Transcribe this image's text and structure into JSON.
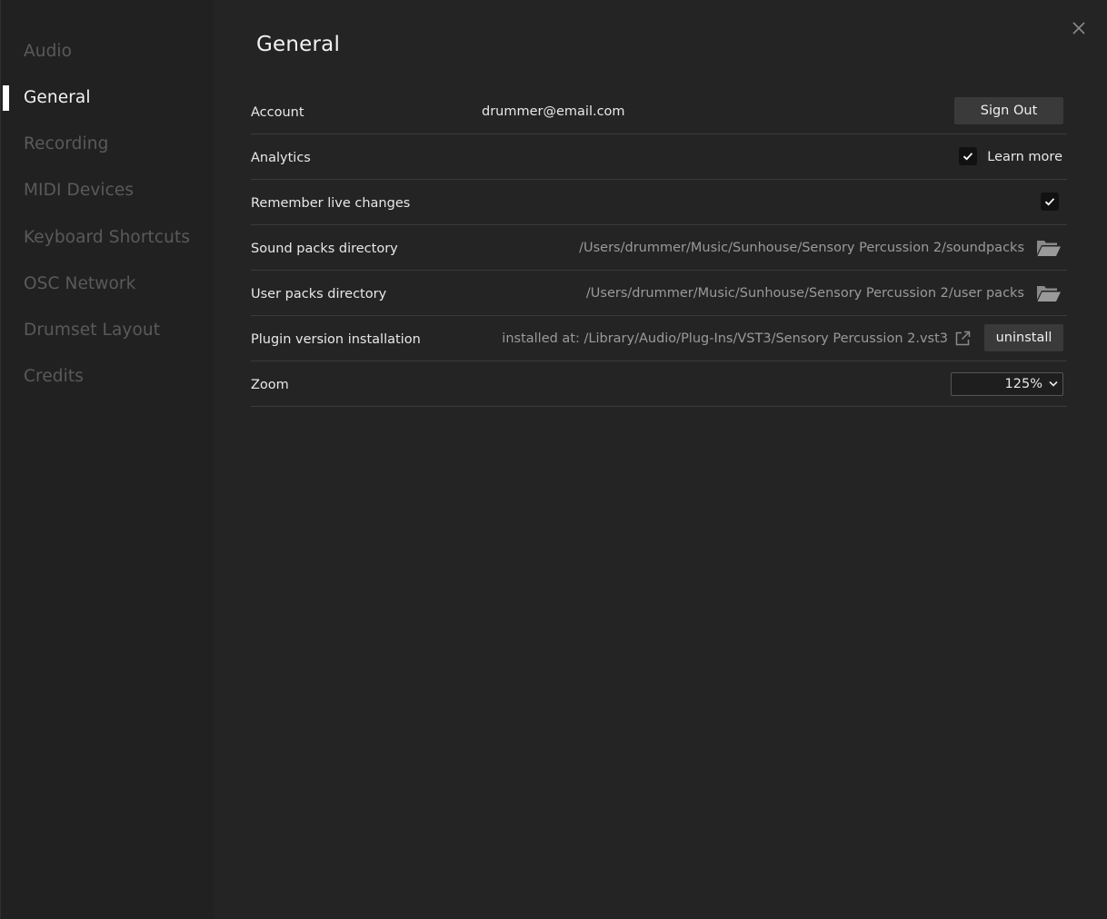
{
  "sidebar": {
    "items": [
      {
        "label": "Audio"
      },
      {
        "label": "General"
      },
      {
        "label": "Recording"
      },
      {
        "label": "MIDI Devices"
      },
      {
        "label": "Keyboard Shortcuts"
      },
      {
        "label": "OSC Network"
      },
      {
        "label": "Drumset Layout"
      },
      {
        "label": "Credits"
      }
    ],
    "active": "General"
  },
  "header": {
    "title": "General"
  },
  "settings": {
    "account": {
      "label": "Account",
      "email": "drummer@email.com",
      "sign_out_label": "Sign Out"
    },
    "analytics": {
      "label": "Analytics",
      "checked": true,
      "learn_more_label": "Learn more"
    },
    "remember_live_changes": {
      "label": "Remember live changes",
      "checked": true
    },
    "sound_packs_directory": {
      "label": "Sound packs directory",
      "path": "/Users/drummer/Music/Sunhouse/Sensory Percussion 2/soundpacks"
    },
    "user_packs_directory": {
      "label": "User packs directory",
      "path": "/Users/drummer/Music/Sunhouse/Sensory Percussion 2/user packs"
    },
    "plugin_version_installation": {
      "label": "Plugin version installation",
      "installed_at": "installed at: /Library/Audio/Plug-Ins/VST3/Sensory Percussion 2.vst3",
      "uninstall_label": "uninstall"
    },
    "zoom": {
      "label": "Zoom",
      "value": "125%"
    }
  },
  "icons": {
    "close": "close-icon",
    "check": "checkmark-icon",
    "folder": "folder-open-icon",
    "external": "external-link-icon",
    "chevron": "chevron-down-icon"
  },
  "colors": {
    "background": "#242424",
    "sidebar": "#212121",
    "active_text": "#f2f2f2",
    "inactive_text": "#5a5a5a",
    "button": "#3a3a3a"
  }
}
